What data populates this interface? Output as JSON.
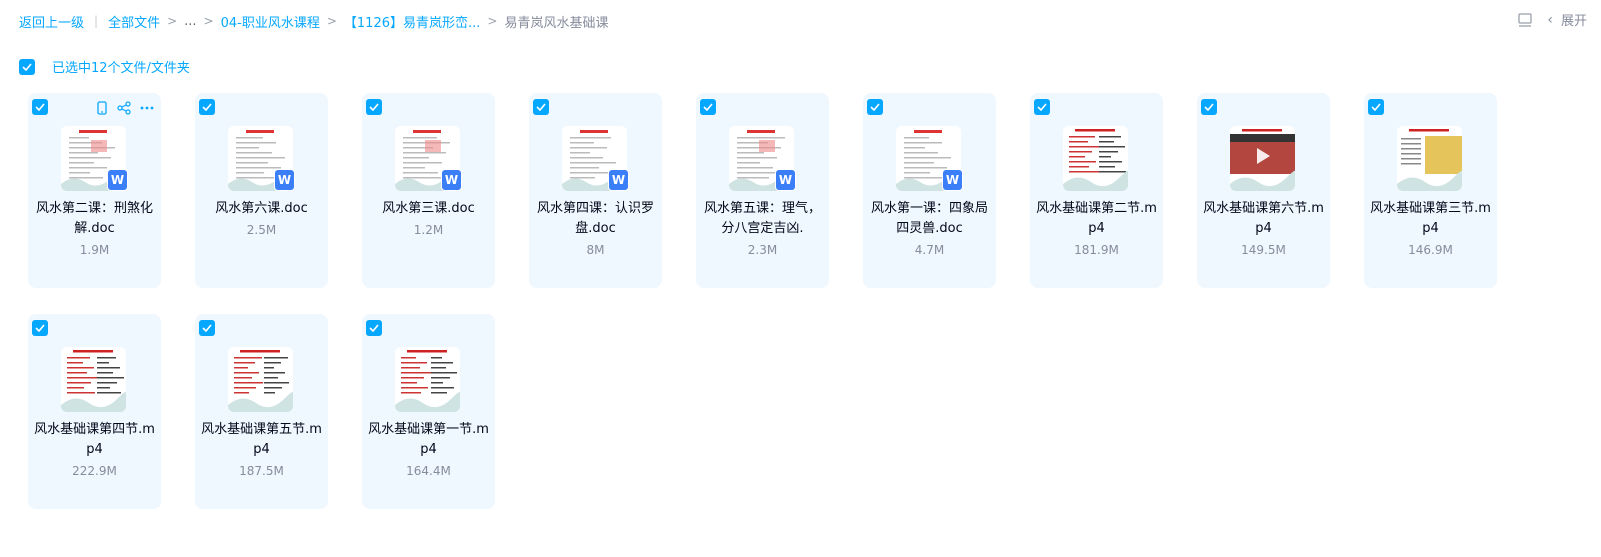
{
  "breadcrumb": {
    "back": "返回上一级",
    "root": "全部文件",
    "ellipsis": "...",
    "level1": "04-职业风水课程",
    "level2": "【1126】易青岚形峦...",
    "current": "易青岚风水基础课"
  },
  "toolbar": {
    "expand_label": "展开"
  },
  "selection": {
    "label": "已选中12个文件/文件夹"
  },
  "files": [
    {
      "name": "风水第二课：刑煞化解.doc",
      "size": "1.9M",
      "type": "doc"
    },
    {
      "name": "风水第六课.doc",
      "size": "2.5M",
      "type": "doc"
    },
    {
      "name": "风水第三课.doc",
      "size": "1.2M",
      "type": "doc"
    },
    {
      "name": "风水第四课：认识罗盘.doc",
      "size": "8M",
      "type": "doc"
    },
    {
      "name": "风水第五课：理气，分八宫定吉凶.",
      "size": "2.3M",
      "type": "doc"
    },
    {
      "name": "风水第一课：四象局四灵兽.doc",
      "size": "4.7M",
      "type": "doc"
    },
    {
      "name": "风水基础课第二节.mp4",
      "size": "181.9M",
      "type": "video"
    },
    {
      "name": "风水基础课第六节.mp4",
      "size": "149.5M",
      "type": "video"
    },
    {
      "name": "风水基础课第三节.mp4",
      "size": "146.9M",
      "type": "video"
    },
    {
      "name": "风水基础课第四节.mp4",
      "size": "222.9M",
      "type": "video"
    },
    {
      "name": "风水基础课第五节.mp4",
      "size": "187.5M",
      "type": "video"
    },
    {
      "name": "风水基础课第一节.mp4",
      "size": "164.4M",
      "type": "video"
    }
  ],
  "colors": {
    "accent": "#06a7ff",
    "card_bg": "#eff7ff",
    "doc_badge": "#3a7ef8"
  }
}
